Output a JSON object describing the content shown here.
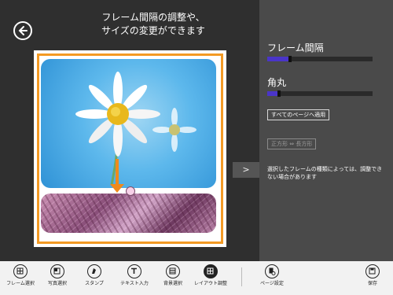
{
  "header": {
    "title_line1": "フレーム間隔の調整や、",
    "title_line2": "サイズの変更ができます"
  },
  "panel": {
    "frame_spacing_label": "フレーム間隔",
    "frame_spacing_value": 0.2,
    "corner_label": "角丸",
    "corner_value": 0.1,
    "apply_all_label": "すべてのページへ適用",
    "square_rect_label": "正方形 ⇔ 長方形",
    "note": "選択したフレームの種類によっては、調整できない場合があります",
    "expand_label": ">"
  },
  "appbar": {
    "items": [
      {
        "label": "フレーム選択",
        "icon": "frame-grid-icon"
      },
      {
        "label": "写真選択",
        "icon": "photo-select-icon"
      },
      {
        "label": "スタンプ",
        "icon": "stamp-icon"
      },
      {
        "label": "テキスト入力",
        "icon": "text-icon"
      },
      {
        "label": "背景選択",
        "icon": "background-icon"
      },
      {
        "label": "レイアウト調整",
        "icon": "layout-icon"
      },
      {
        "label": "ページ設定",
        "icon": "page-settings-icon"
      },
      {
        "label": "保存",
        "icon": "save-icon"
      }
    ]
  },
  "colors": {
    "accent": "#f39a24",
    "slider_fill": "#4a35c9"
  }
}
